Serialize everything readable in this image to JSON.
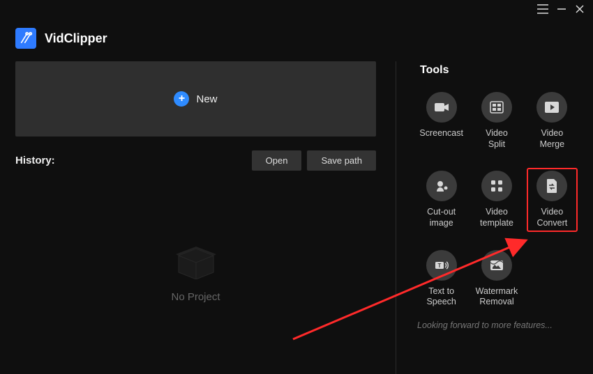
{
  "app": {
    "title": "VidClipper"
  },
  "new_button": {
    "label": "New"
  },
  "history": {
    "label": "History:",
    "open_label": "Open",
    "save_path_label": "Save path",
    "empty_label": "No Project"
  },
  "tools": {
    "title": "Tools",
    "items": [
      {
        "label": "Screencast",
        "icon": "camera-icon"
      },
      {
        "label": "Video\nSplit",
        "icon": "split-icon"
      },
      {
        "label": "Video\nMerge",
        "icon": "play-icon"
      },
      {
        "label": "Cut-out\nimage",
        "icon": "cutout-icon"
      },
      {
        "label": "Video\ntemplate",
        "icon": "template-icon"
      },
      {
        "label": "Video\nConvert",
        "icon": "convert-icon",
        "highlight": true
      },
      {
        "label": "Text to\nSpeech",
        "icon": "tts-icon"
      },
      {
        "label": "Watermark\nRemoval",
        "icon": "watermark-icon"
      }
    ],
    "more_label": "Looking forward to more features..."
  },
  "annotation": {
    "highlight_target": "Video Convert"
  }
}
